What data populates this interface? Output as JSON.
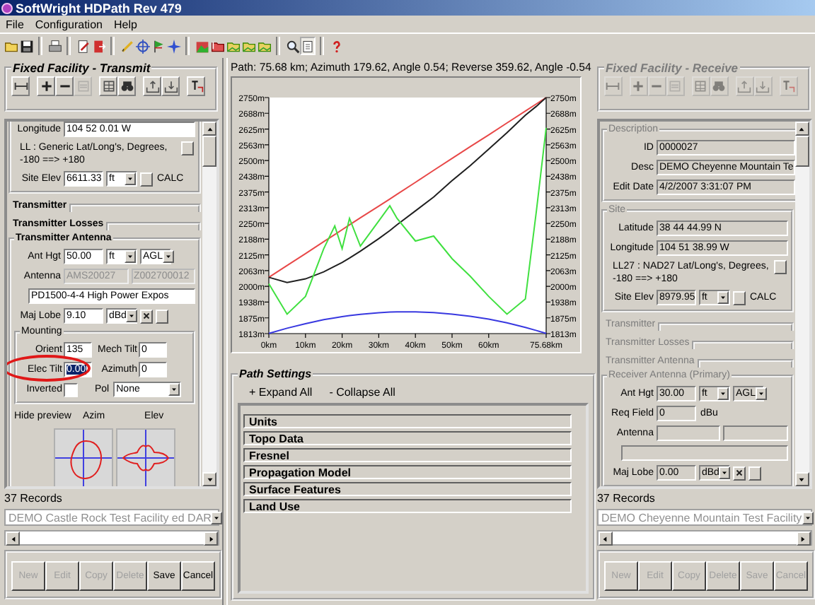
{
  "window": {
    "title": "SoftWright HDPath Rev 479"
  },
  "menu": [
    {
      "label": "File"
    },
    {
      "label": "Configuration"
    },
    {
      "label": "Help"
    }
  ],
  "toolbar": [
    {
      "selected": false
    },
    {
      "selected": false
    },
    {
      "selected": false
    },
    {
      "selected": false
    },
    {
      "selected": false
    },
    {
      "selected": false
    },
    {
      "selected": false
    },
    {
      "selected": false
    },
    {
      "selected": false
    },
    {
      "selected": false
    },
    {
      "selected": false
    },
    {
      "selected": false
    },
    {
      "selected": false
    },
    {
      "selected": false
    },
    {
      "selected": false
    },
    {
      "selected": true
    },
    {
      "selected": false
    }
  ],
  "transmit": {
    "title": "Fixed Facility - Transmit",
    "disabled": false,
    "tools": [
      {
        "disabled": false
      },
      {
        "disabled": false
      },
      {
        "disabled": false
      },
      {
        "disabled": true
      },
      {
        "disabled": false
      },
      {
        "disabled": false
      },
      {
        "disabled": false
      },
      {
        "disabled": false
      },
      {
        "disabled": false
      }
    ],
    "rows": [
      {
        "kind": "group",
        "rows": [
          {
            "kind": "field",
            "label": "Longitude",
            "field": {
              "value": "104 52 0.01 W",
              "disabled": false
            }
          },
          {
            "kind": "note",
            "text": "LL : Generic Lat/Long's, Degrees, -180 ==> +180"
          },
          {
            "kind": "field",
            "label": "Site Elev",
            "field": {
              "value": "6611.33",
              "disabled": false
            },
            "extras": [
              {
                "kind": "select",
                "value": "ft"
              },
              {
                "kind": "button"
              },
              {
                "kind": "text",
                "text": "CALC"
              }
            ]
          }
        ]
      },
      {
        "kind": "section",
        "label": "Transmitter",
        "disabled": false
      },
      {
        "kind": "section",
        "label": "Transmitter Losses",
        "disabled": false
      },
      {
        "kind": "group",
        "legend": "Transmitter Antenna",
        "disabled": false,
        "rows": [
          {
            "kind": "field",
            "label": "Ant Hgt",
            "field": {
              "value": "50.00",
              "disabled": false
            },
            "extras": [
              {
                "kind": "select",
                "value": "ft"
              },
              {
                "kind": "select",
                "value": "AGL"
              }
            ]
          },
          {
            "kind": "antenna",
            "label": "Antenna",
            "fields": [
              {
                "value": "AMS20027",
                "disabled": true
              },
              {
                "value": "Z002700012",
                "disabled": true
              }
            ],
            "line": {
              "value": "PD1500-4-4 High Power Expos",
              "disabled": false
            }
          },
          {
            "kind": "field",
            "label": "Maj Lobe",
            "field": {
              "value": "9.10",
              "disabled": false
            },
            "extras": [
              {
                "kind": "select",
                "value": "dBd"
              },
              {
                "kind": "xbutton"
              },
              {
                "kind": "button"
              }
            ]
          },
          {
            "kind": "group",
            "legend": "Mounting",
            "disabled": false,
            "rows": [
              {
                "kind": "pair",
                "items": [
                  {
                    "label": "Orient",
                    "value": "135",
                    "selected": false,
                    "circled": false
                  },
                  {
                    "label": "Mech Tilt",
                    "value": "0",
                    "selected": false,
                    "circled": false
                  }
                ]
              },
              {
                "kind": "pair",
                "items": [
                  {
                    "label": "Elec Tilt",
                    "value": "0.00",
                    "selected": true,
                    "circled": true
                  },
                  {
                    "label": "Azimuth",
                    "value": "0",
                    "selected": false,
                    "circled": false
                  }
                ]
              },
              {
                "kind": "check",
                "label": "Inverted",
                "checked": false,
                "select_label": "Pol",
                "select": "None"
              }
            ]
          },
          {
            "kind": "preview",
            "toggle": "Hide preview",
            "labels": [
              "Azim",
              "Elev"
            ]
          }
        ]
      }
    ],
    "records": "37 Records",
    "record": {
      "value": "DEMO Castle Rock Test Facility ed DAR",
      "disabled": true
    },
    "buttons": [
      {
        "label": "New",
        "disabled": true
      },
      {
        "label": "Edit",
        "disabled": true
      },
      {
        "label": "Copy",
        "disabled": true
      },
      {
        "label": "Delete",
        "disabled": true
      },
      {
        "label": "Save",
        "disabled": false
      },
      {
        "label": "Cancel",
        "disabled": false
      }
    ]
  },
  "path_view": {
    "summary": "Path: 75.68 km; Azimuth 179.62, Angle 0.54; Reverse 359.62, Angle -0.54",
    "chart_data": {
      "type": "line",
      "x": [
        0,
        5,
        10,
        15,
        18,
        20,
        22,
        25,
        30,
        33,
        35,
        40,
        45,
        50,
        55,
        60,
        65,
        70,
        73,
        75.68
      ],
      "series": [
        {
          "color": "#e84848",
          "values": [
            2036,
            2083,
            2130,
            2178,
            2206,
            2225,
            2244,
            2272,
            2319,
            2347,
            2366,
            2413,
            2461,
            2508,
            2555,
            2602,
            2649,
            2696,
            2725,
            2750
          ]
        },
        {
          "color": "#202020",
          "values": [
            2036,
            2015,
            2030,
            2058,
            2080,
            2095,
            2112,
            2140,
            2190,
            2222,
            2245,
            2300,
            2355,
            2420,
            2480,
            2545,
            2610,
            2680,
            2715,
            2750
          ]
        },
        {
          "color": "#40e040",
          "values": [
            2010,
            1890,
            1960,
            2150,
            2240,
            2150,
            2270,
            2160,
            2260,
            2320,
            2270,
            2180,
            2200,
            2110,
            2040,
            1960,
            1890,
            1950,
            2300,
            2630
          ]
        },
        {
          "color": "#3838e0",
          "values": [
            1813,
            1834,
            1852,
            1868,
            1875,
            1880,
            1884,
            1889,
            1895,
            1898,
            1899,
            1899,
            1896,
            1890,
            1881,
            1870,
            1855,
            1837,
            1825,
            1813
          ]
        }
      ],
      "xlim": [
        0,
        75.68
      ],
      "ylim": [
        1812.5,
        2750
      ],
      "xticks": [
        {
          "value": 0,
          "label": "0km"
        },
        {
          "value": 10,
          "label": "10km"
        },
        {
          "value": 20,
          "label": "20km"
        },
        {
          "value": 30,
          "label": "30km"
        },
        {
          "value": 40,
          "label": "40km"
        },
        {
          "value": 50,
          "label": "50km"
        },
        {
          "value": 60,
          "label": "60km"
        },
        {
          "value": 75.68,
          "label": "75.68km"
        }
      ],
      "yticks": [
        {
          "value": 1812.5,
          "label": "1813m"
        },
        {
          "value": 1875,
          "label": "1875m"
        },
        {
          "value": 1937.5,
          "label": "1938m"
        },
        {
          "value": 2000,
          "label": "2000m"
        },
        {
          "value": 2062.5,
          "label": "2063m"
        },
        {
          "value": 2125,
          "label": "2125m"
        },
        {
          "value": 2187.5,
          "label": "2188m"
        },
        {
          "value": 2250,
          "label": "2250m"
        },
        {
          "value": 2312.5,
          "label": "2313m"
        },
        {
          "value": 2375,
          "label": "2375m"
        },
        {
          "value": 2437.5,
          "label": "2438m"
        },
        {
          "value": 2500,
          "label": "2500m"
        },
        {
          "value": 2562.5,
          "label": "2563m"
        },
        {
          "value": 2625,
          "label": "2625m"
        },
        {
          "value": 2687.5,
          "label": "2688m"
        },
        {
          "value": 2750,
          "label": "2750m"
        }
      ]
    }
  },
  "path_settings": {
    "title": "Path Settings",
    "actions": [
      {
        "label": "+ Expand All"
      },
      {
        "label": "- Collapse All"
      }
    ],
    "sections": [
      {
        "label": "Units"
      },
      {
        "label": "Topo Data"
      },
      {
        "label": "Fresnel"
      },
      {
        "label": "Propagation Model"
      },
      {
        "label": "Surface Features"
      },
      {
        "label": "Land Use"
      }
    ]
  },
  "receive": {
    "title": "Fixed Facility - Receive",
    "disabled": true,
    "tools": [
      {
        "disabled": true
      },
      {
        "disabled": true
      },
      {
        "disabled": true
      },
      {
        "disabled": true
      },
      {
        "disabled": true
      },
      {
        "disabled": true
      },
      {
        "disabled": true
      },
      {
        "disabled": true
      },
      {
        "disabled": true
      }
    ],
    "rows": [
      {
        "kind": "group",
        "legend": "Description",
        "disabled": true,
        "rows": [
          {
            "kind": "field",
            "label": "ID",
            "field": {
              "value": "0000027",
              "disabled": false
            }
          },
          {
            "kind": "field",
            "label": "Desc",
            "field": {
              "value": "DEMO Cheyenne Mountain Te",
              "disabled": false
            }
          },
          {
            "kind": "field",
            "label": "Edit Date",
            "field": {
              "value": "4/2/2007 3:31:07 PM",
              "disabled": false
            }
          }
        ]
      },
      {
        "kind": "group",
        "legend": "Site",
        "disabled": true,
        "rows": [
          {
            "kind": "field",
            "label": "Latitude",
            "field": {
              "value": "38 44 44.99 N",
              "disabled": false
            }
          },
          {
            "kind": "field",
            "label": "Longitude",
            "field": {
              "value": "104 51 38.99 W",
              "disabled": false
            }
          },
          {
            "kind": "note",
            "text": "LL27 : NAD27 Lat/Long's, Degrees, -180 ==> +180"
          },
          {
            "kind": "field",
            "label": "Site Elev",
            "field": {
              "value": "8979.95",
              "disabled": false
            },
            "extras": [
              {
                "kind": "select",
                "value": "ft"
              },
              {
                "kind": "button"
              },
              {
                "kind": "text",
                "text": "CALC"
              }
            ]
          }
        ]
      },
      {
        "kind": "section",
        "label": "Transmitter",
        "disabled": true
      },
      {
        "kind": "section",
        "label": "Transmitter Losses",
        "disabled": true
      },
      {
        "kind": "section",
        "label": "Transmitter Antenna",
        "disabled": true
      },
      {
        "kind": "group",
        "legend": "Receiver Antenna (Primary)",
        "disabled": true,
        "rows": [
          {
            "kind": "field",
            "label": "Ant Hgt",
            "field": {
              "value": "30.00",
              "disabled": false
            },
            "extras": [
              {
                "kind": "select",
                "value": "ft"
              },
              {
                "kind": "select",
                "value": "AGL"
              }
            ]
          },
          {
            "kind": "field",
            "label": "Req Field",
            "field": {
              "value": "0",
              "disabled": false
            },
            "extras": [
              {
                "kind": "text",
                "text": "dBu"
              }
            ]
          },
          {
            "kind": "antenna",
            "label": "Antenna",
            "fields": [
              {
                "disabled": false
              },
              {
                "disabled": false
              }
            ],
            "line": {
              "disabled": false
            }
          },
          {
            "kind": "field",
            "label": "Maj Lobe",
            "field": {
              "value": "0.00",
              "disabled": false
            },
            "extras": [
              {
                "kind": "select",
                "value": "dBd"
              },
              {
                "kind": "xbutton"
              },
              {
                "kind": "button"
              }
            ]
          }
        ]
      }
    ],
    "records": "37 Records",
    "record": {
      "value": "DEMO Cheyenne Mountain Test Facility",
      "disabled": true
    },
    "buttons": [
      {
        "label": "New",
        "disabled": true
      },
      {
        "label": "Edit",
        "disabled": true
      },
      {
        "label": "Copy",
        "disabled": true
      },
      {
        "label": "Delete",
        "disabled": true
      },
      {
        "label": "Save",
        "disabled": true
      },
      {
        "label": "Cancel",
        "disabled": true
      }
    ]
  }
}
